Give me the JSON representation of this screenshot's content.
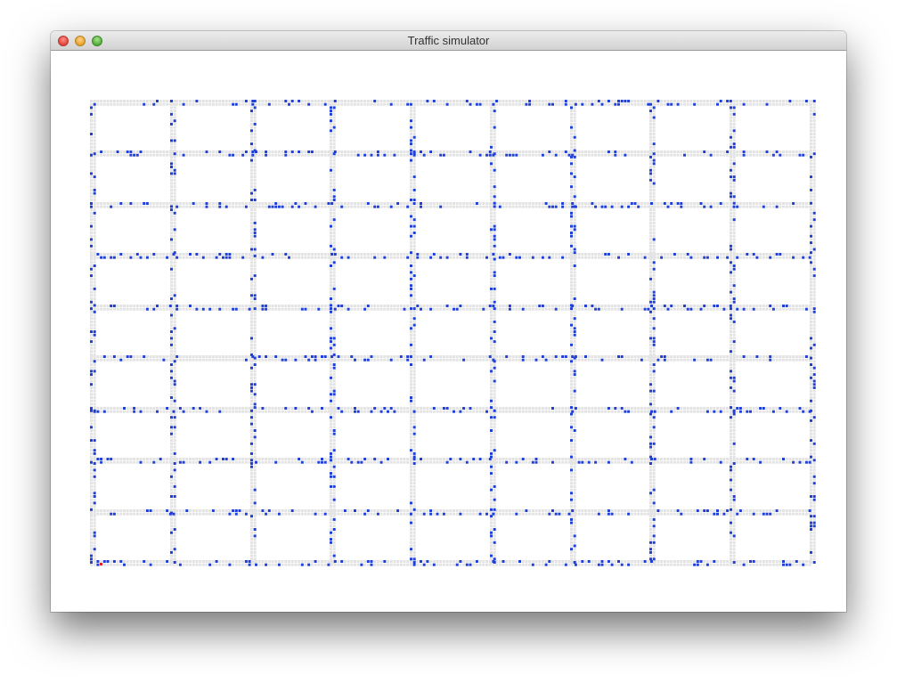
{
  "window": {
    "title": "Traffic simulator"
  },
  "simulation": {
    "grid_columns": 9,
    "grid_rows": 9,
    "colors": {
      "road": "#e3e3e3",
      "car": "#1f3fd6",
      "highlight_car": "#e0241c"
    }
  }
}
